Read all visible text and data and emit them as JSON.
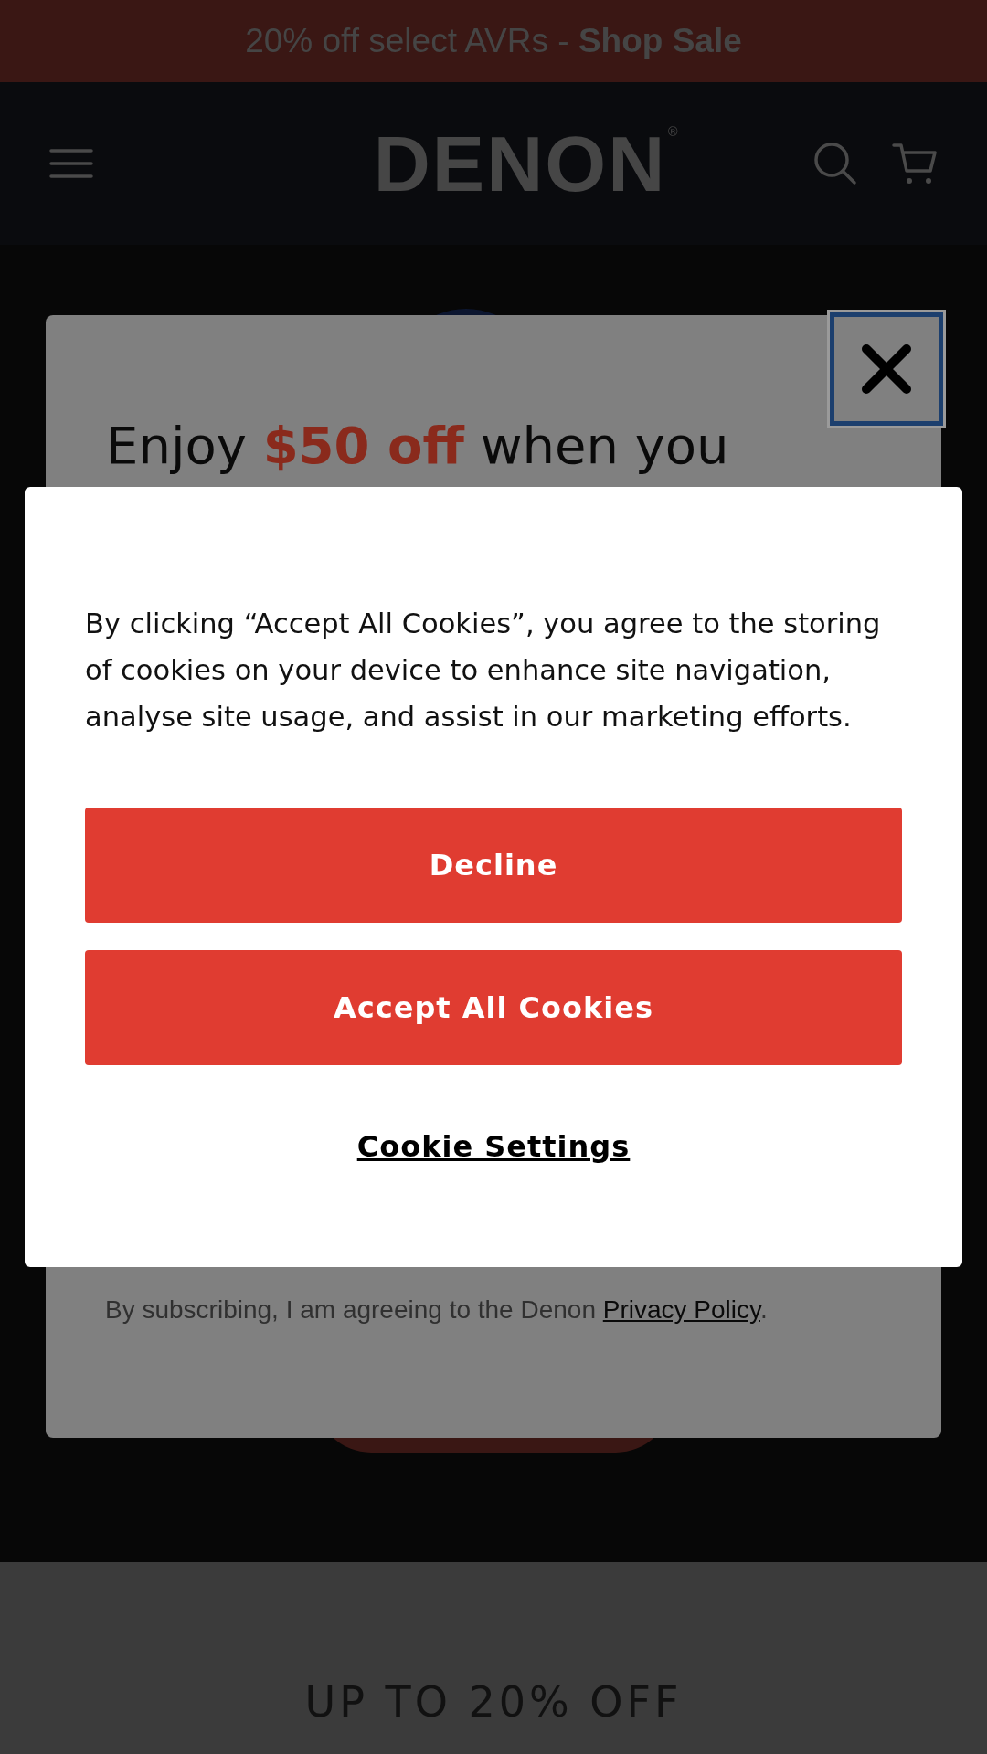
{
  "banner": {
    "text": "20% off select AVRs - ",
    "link": "Shop Sale"
  },
  "header": {
    "logo": "DENON",
    "logo_mark": "®"
  },
  "newsletter": {
    "title": "Enjoy **$50 off** when you",
    "consent_before": "By subscribing, I am agreeing to the Denon ",
    "consent_link": "Privacy Policy",
    "consent_after": "."
  },
  "cookie_dialog": {
    "message": "By clicking “Accept All Cookies”, you agree to the storing of cookies on your device to enhance site navigation, analyse site usage, and assist in our marketing efforts.",
    "buttons": [
      "Decline",
      "Accept All Cookies"
    ],
    "settings_link": "Cookie Settings"
  },
  "promo": {
    "heading": "UP TO 20% OFF"
  }
}
